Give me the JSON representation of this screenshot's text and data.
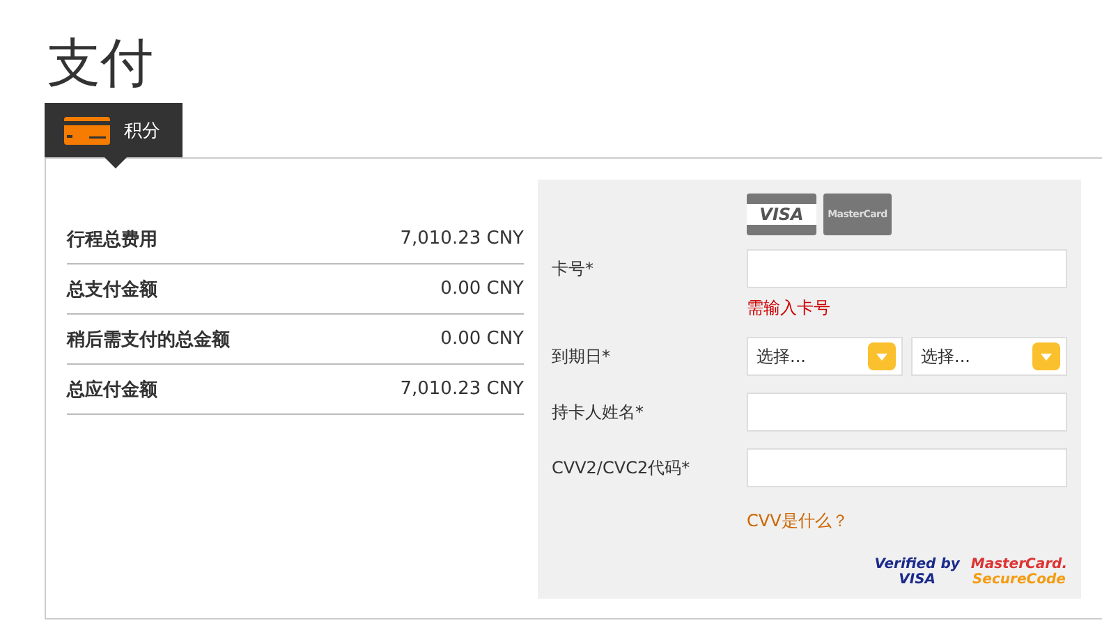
{
  "page_title": "支付",
  "tabs": [
    {
      "label": "积分",
      "selected": true
    }
  ],
  "summary_rows": [
    {
      "label": "行程总费用",
      "amount": "7,010.23 CNY"
    },
    {
      "label": "总支付金额",
      "amount": "0.00 CNY"
    },
    {
      "label": "稍后需支付的总金额",
      "amount": "0.00 CNY"
    },
    {
      "label": "总应付金额",
      "amount": "7,010.23 CNY"
    }
  ],
  "card_logos": [
    {
      "kind": "visa",
      "text": "VISA"
    },
    {
      "kind": "mastercard",
      "text": "MasterCard"
    }
  ],
  "form_fields": [
    {
      "kind": "text",
      "label": "卡号*",
      "error": "需输入卡号"
    },
    {
      "kind": "selects",
      "label": "到期日*",
      "selects": [
        "选择...",
        "选择..."
      ]
    },
    {
      "kind": "text",
      "label": "持卡人姓名*"
    },
    {
      "kind": "text",
      "label": "CVV2/CVC2代码*"
    }
  ],
  "help_link": "CVV是什么？",
  "security_logos": [
    {
      "kind": "verified-visa",
      "lines": [
        "Verified by",
        "VISA"
      ]
    },
    {
      "kind": "securecode",
      "lines": [
        "MasterCard.",
        "SecureCode"
      ]
    }
  ]
}
